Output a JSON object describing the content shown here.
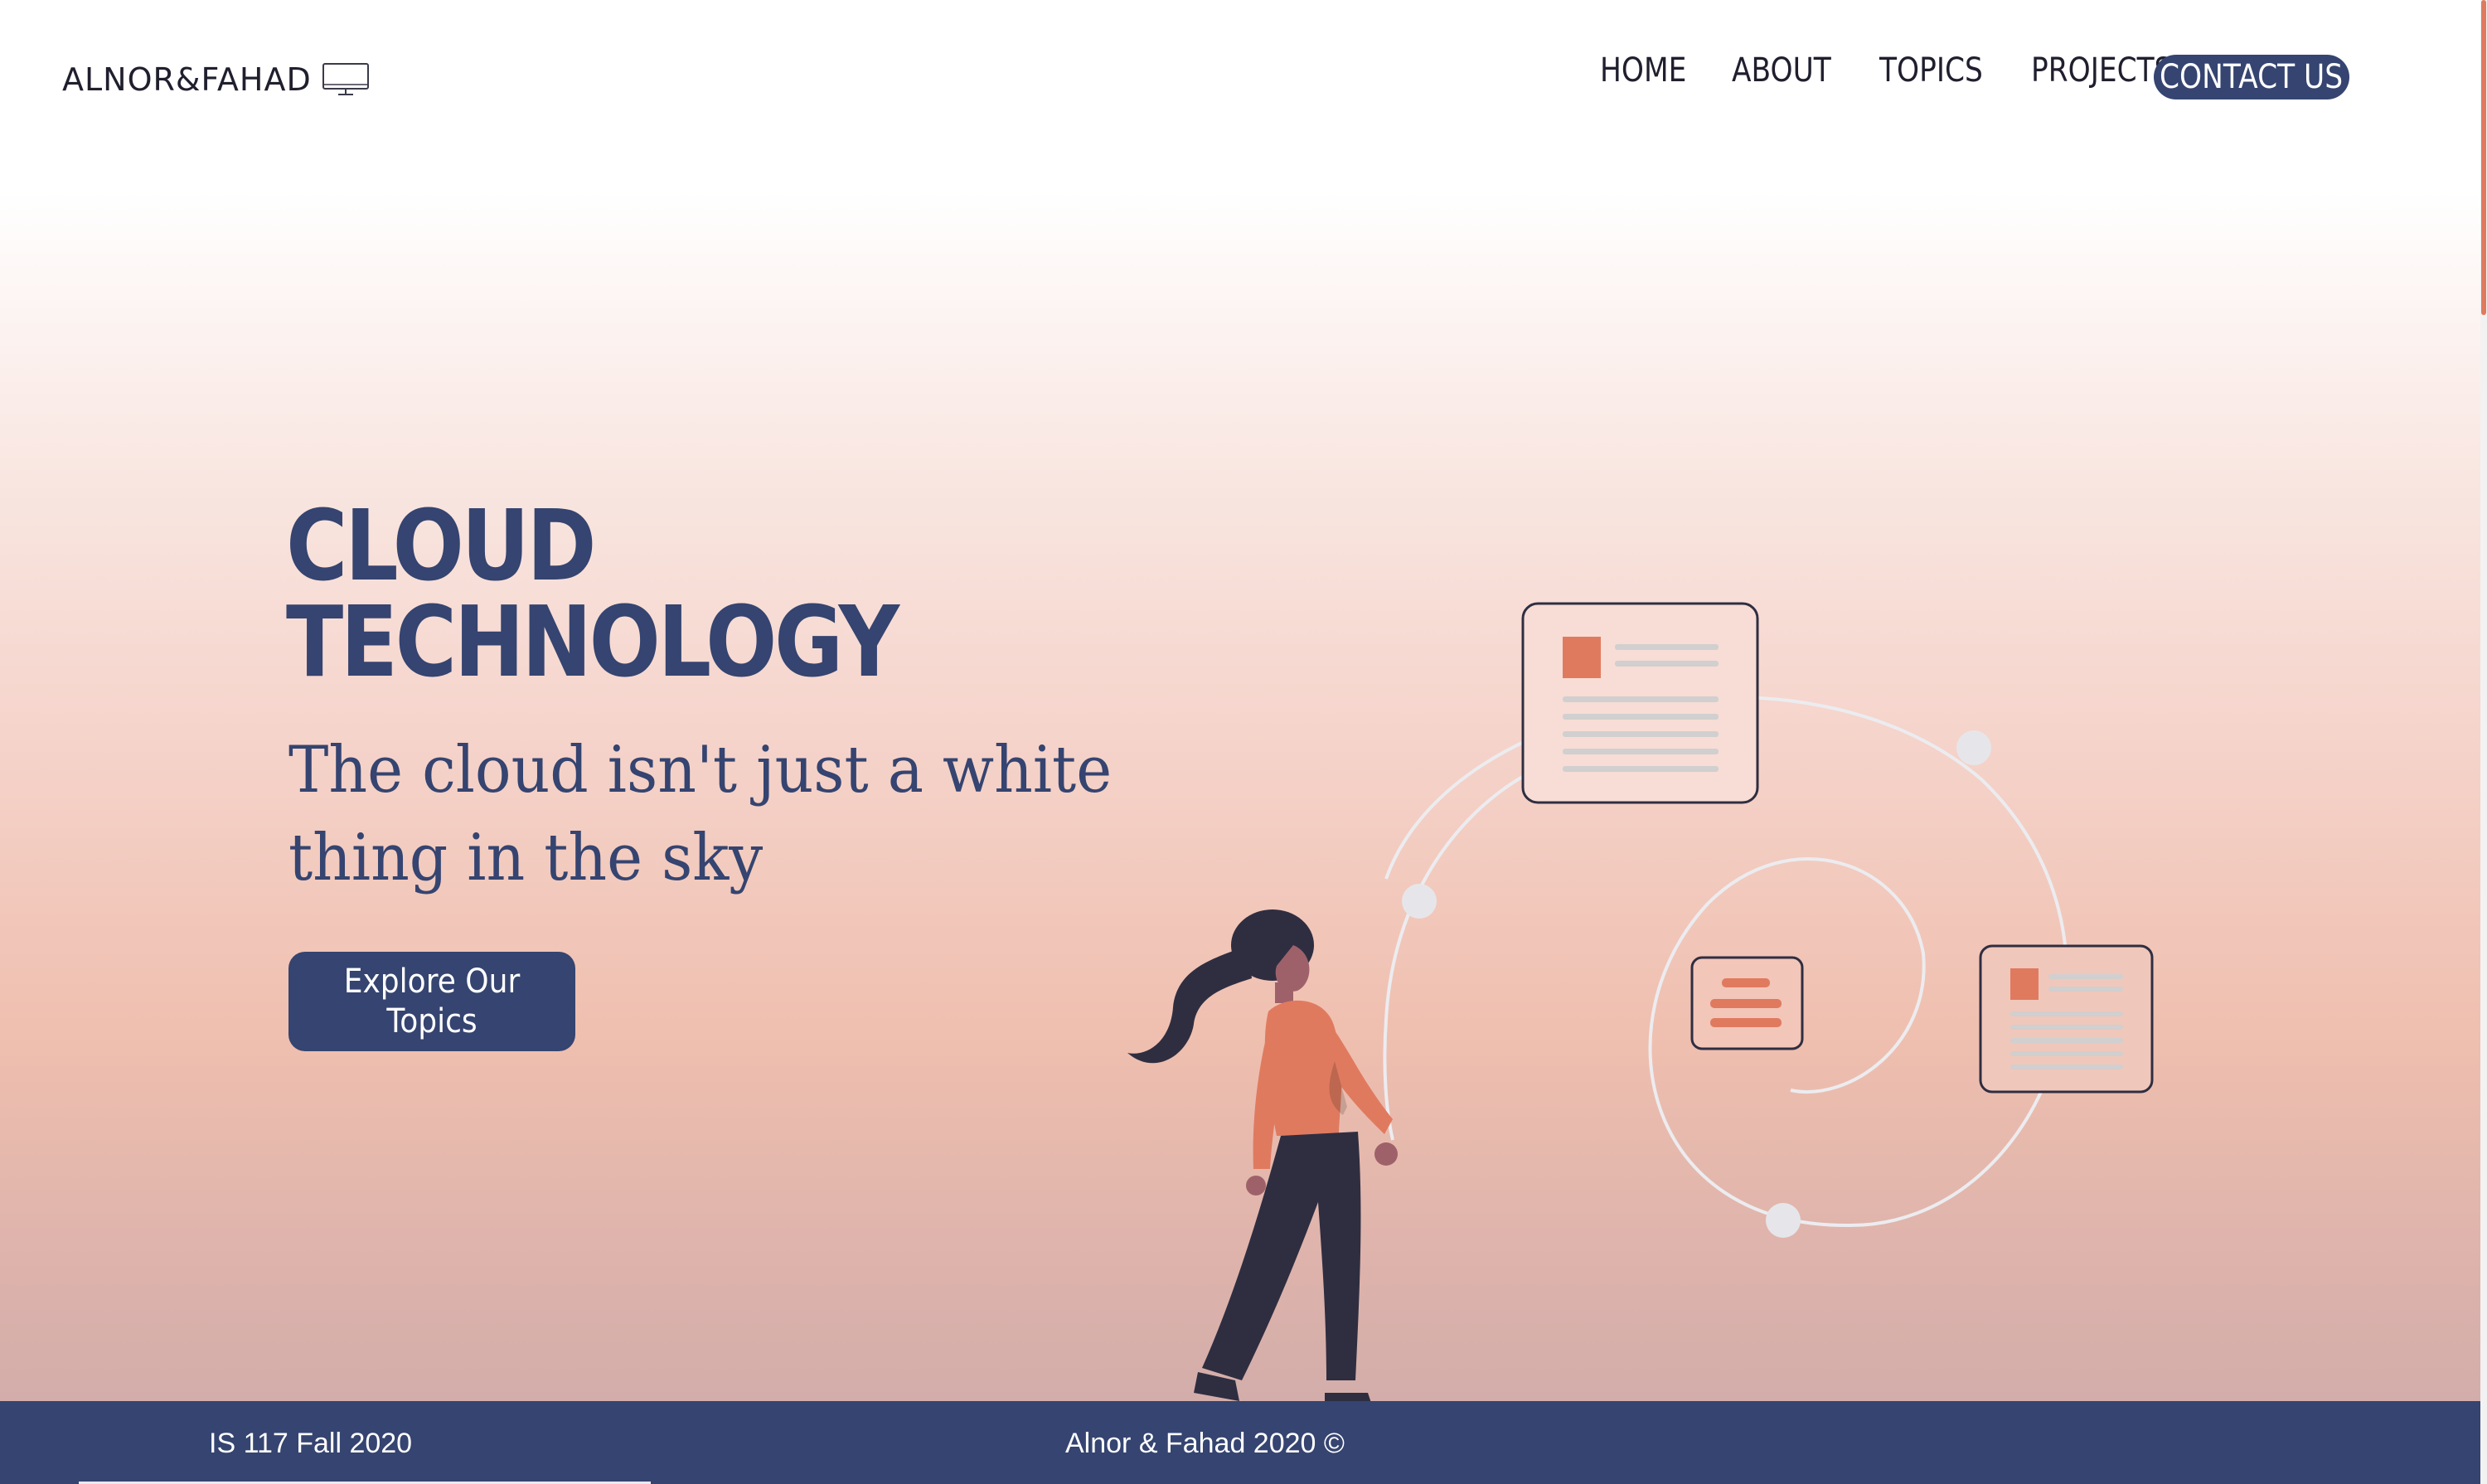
{
  "header": {
    "logo_text": "ALNOR&FAHAD",
    "logo_icon": "monitor-icon",
    "nav": {
      "home": "HOME",
      "about": "ABOUT",
      "topics": "TOPICS",
      "projects": "PROJECTS",
      "contact": "CONTACT US"
    }
  },
  "hero": {
    "title_line1": "CLOUD",
    "title_line2": "TECHNOLOGY",
    "subtitle": "The cloud isn't just a white thing in the sky",
    "cta_label": "Explore Our Topics"
  },
  "footer": {
    "left": "IS 117 Fall 2020",
    "center": "Alnor & Fahad 2020 ©"
  },
  "colors": {
    "primary": "#354470",
    "accent": "#e07a5f",
    "gradient_bottom": "#d3adaa"
  }
}
